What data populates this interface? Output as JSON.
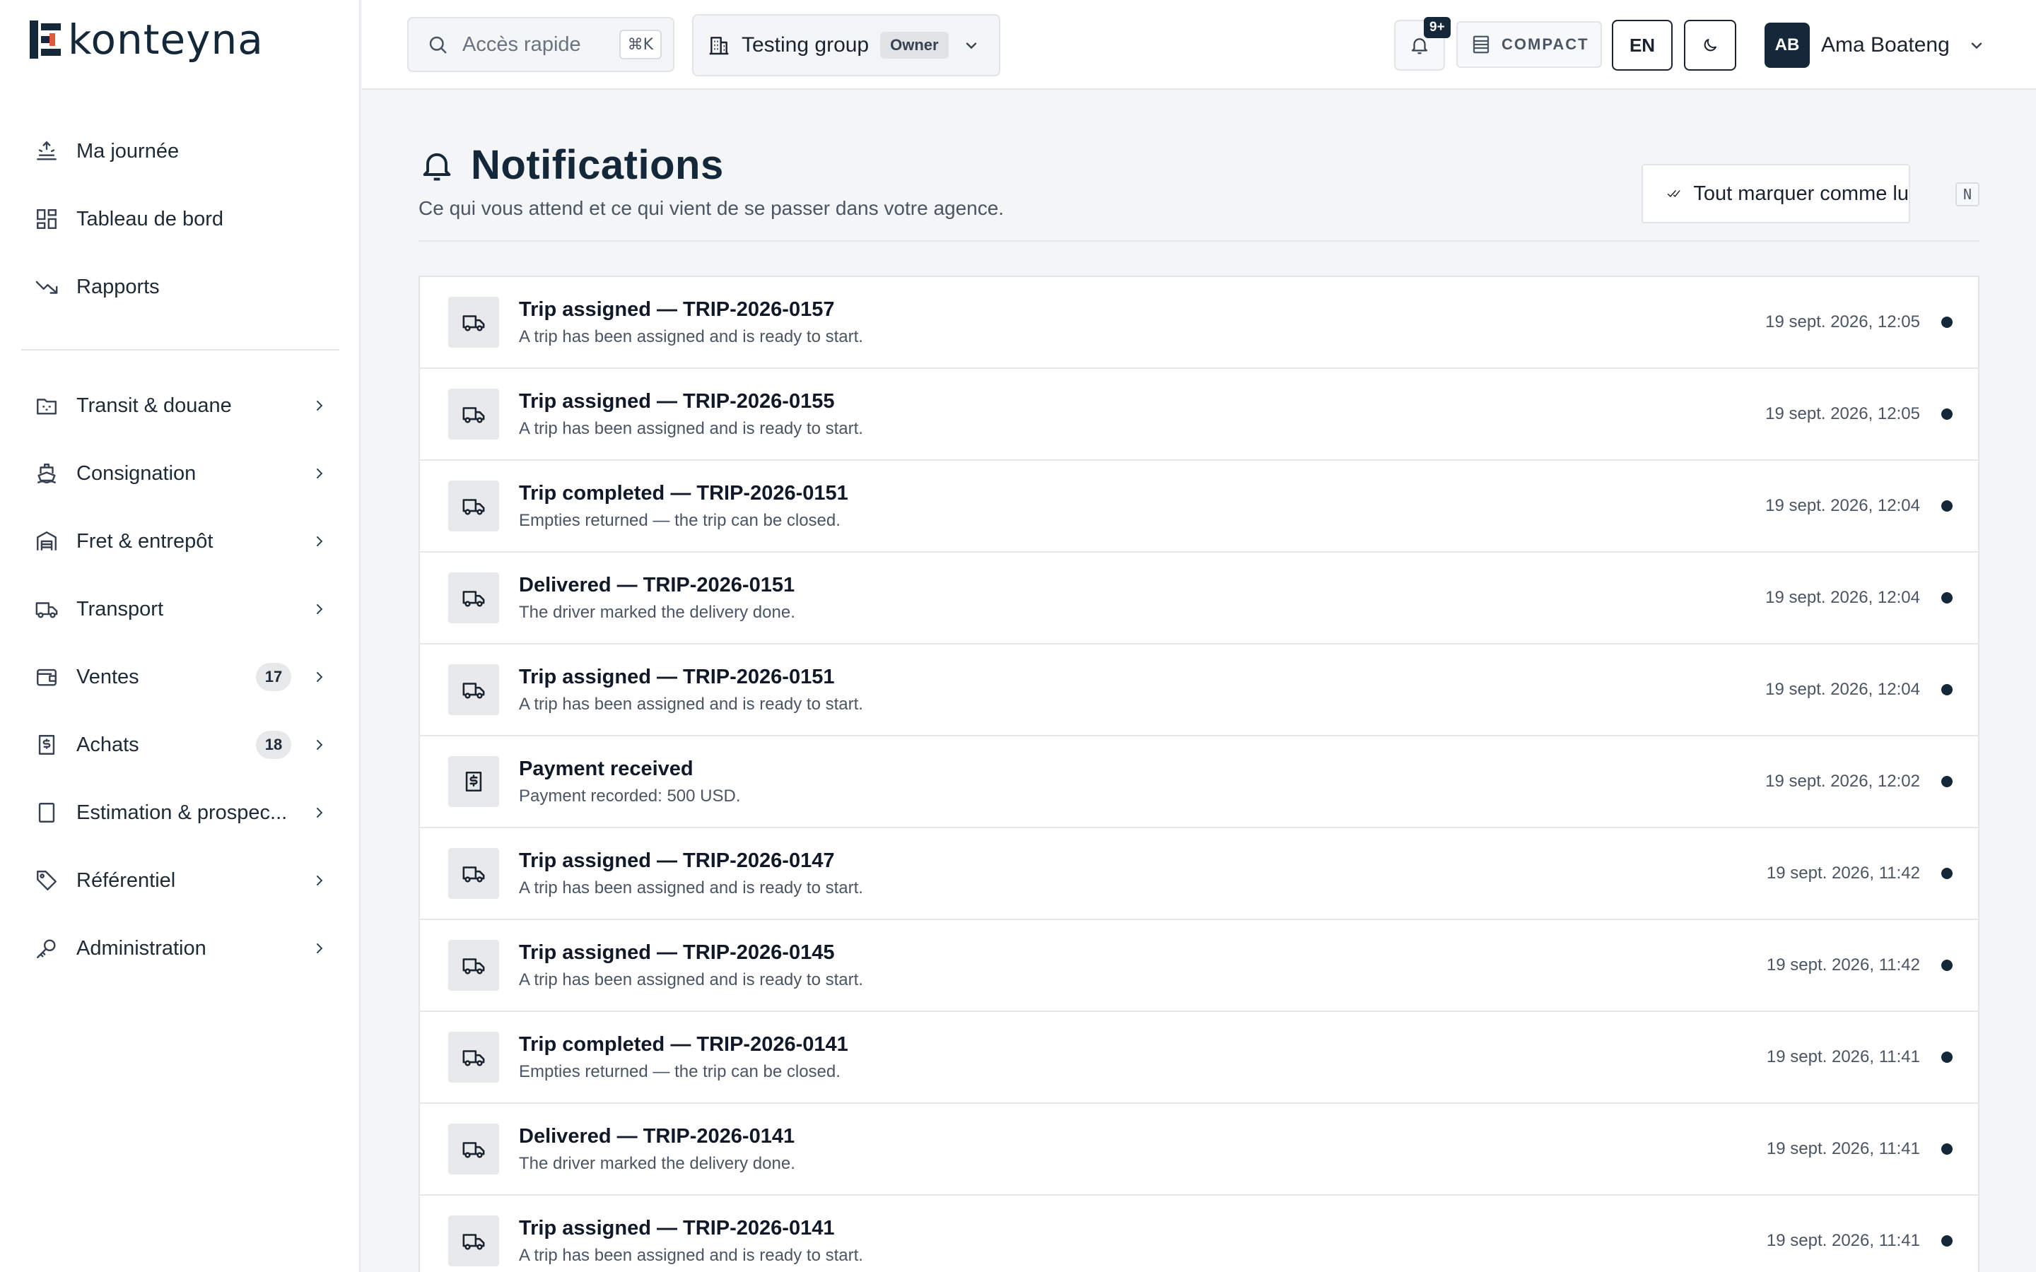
{
  "app": {
    "logo_text": "konteyna"
  },
  "sidebar": {
    "top_items": [
      {
        "label": "Ma journée",
        "icon": "sunrise-icon"
      },
      {
        "label": "Tableau de bord",
        "icon": "dashboard-grid-icon"
      },
      {
        "label": "Rapports",
        "icon": "trend-down-icon"
      }
    ],
    "items": [
      {
        "label": "Transit & douane",
        "icon": "customs-folder-icon",
        "badge": null
      },
      {
        "label": "Consignation",
        "icon": "ship-icon",
        "badge": null
      },
      {
        "label": "Fret & entrepôt",
        "icon": "warehouse-icon",
        "badge": null
      },
      {
        "label": "Transport",
        "icon": "truck-icon",
        "badge": null
      },
      {
        "label": "Ventes",
        "icon": "wallet-icon",
        "badge": "17"
      },
      {
        "label": "Achats",
        "icon": "invoice-dollar-icon",
        "badge": "18"
      },
      {
        "label": "Estimation & prospec...",
        "icon": "calculator-icon",
        "badge": null
      },
      {
        "label": "Référentiel",
        "icon": "tag-icon",
        "badge": null
      },
      {
        "label": "Administration",
        "icon": "key-icon",
        "badge": null
      }
    ]
  },
  "topbar": {
    "search": {
      "label": "Accès rapide",
      "shortcut": "⌘K"
    },
    "group": {
      "name": "Testing group",
      "role": "Owner"
    },
    "notifications_badge": "9+",
    "compact_label": "COMPACT",
    "language": "EN",
    "user": {
      "initials": "AB",
      "name": "Ama Boateng"
    }
  },
  "page": {
    "title": "Notifications",
    "subtitle": "Ce qui vous attend et ce qui vient de se passer dans votre agence.",
    "mark_all_label": "Tout marquer comme lu",
    "mark_all_shortcut": "N"
  },
  "notifications": [
    {
      "title": "Trip assigned — TRIP-2026-0157",
      "desc": "A trip has been assigned and is ready to start.",
      "time": "19 sept. 2026, 12:05",
      "icon": "truck-icon"
    },
    {
      "title": "Trip assigned — TRIP-2026-0155",
      "desc": "A trip has been assigned and is ready to start.",
      "time": "19 sept. 2026, 12:05",
      "icon": "truck-icon"
    },
    {
      "title": "Trip completed — TRIP-2026-0151",
      "desc": "Empties returned — the trip can be closed.",
      "time": "19 sept. 2026, 12:04",
      "icon": "truck-icon"
    },
    {
      "title": "Delivered — TRIP-2026-0151",
      "desc": "The driver marked the delivery done.",
      "time": "19 sept. 2026, 12:04",
      "icon": "truck-icon"
    },
    {
      "title": "Trip assigned — TRIP-2026-0151",
      "desc": "A trip has been assigned and is ready to start.",
      "time": "19 sept. 2026, 12:04",
      "icon": "truck-icon"
    },
    {
      "title": "Payment received",
      "desc": "Payment recorded: 500 USD.",
      "time": "19 sept. 2026, 12:02",
      "icon": "invoice-dollar-icon"
    },
    {
      "title": "Trip assigned — TRIP-2026-0147",
      "desc": "A trip has been assigned and is ready to start.",
      "time": "19 sept. 2026, 11:42",
      "icon": "truck-icon"
    },
    {
      "title": "Trip assigned — TRIP-2026-0145",
      "desc": "A trip has been assigned and is ready to start.",
      "time": "19 sept. 2026, 11:42",
      "icon": "truck-icon"
    },
    {
      "title": "Trip completed — TRIP-2026-0141",
      "desc": "Empties returned — the trip can be closed.",
      "time": "19 sept. 2026, 11:41",
      "icon": "truck-icon"
    },
    {
      "title": "Delivered — TRIP-2026-0141",
      "desc": "The driver marked the delivery done.",
      "time": "19 sept. 2026, 11:41",
      "icon": "truck-icon"
    },
    {
      "title": "Trip assigned — TRIP-2026-0141",
      "desc": "A trip has been assigned and is ready to start.",
      "time": "19 sept. 2026, 11:41",
      "icon": "truck-icon"
    }
  ],
  "colors": {
    "brand": "#14283a",
    "unread_dot": "#14283a"
  }
}
